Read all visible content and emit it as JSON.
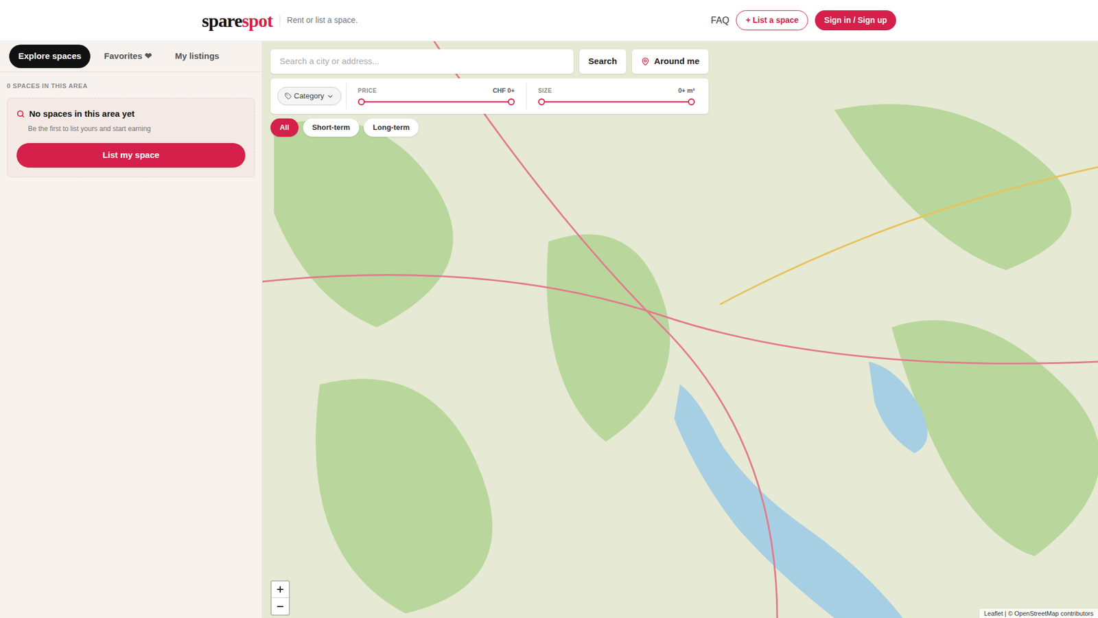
{
  "header": {
    "logo": {
      "part1": "spare",
      "part2": "spot"
    },
    "tagline": "Rent or list a space.",
    "faq": "FAQ",
    "list_button": "+ List a space",
    "sign_in_button": "Sign in / Sign up"
  },
  "sidebar": {
    "tabs": [
      {
        "label": "Explore spaces",
        "selected": true
      },
      {
        "label": "Favorites ❤",
        "selected": false
      },
      {
        "label": "My listings",
        "selected": false
      }
    ],
    "count": "0 SPACES IN THIS AREA",
    "empty_card": {
      "title": "No spaces in this area yet",
      "subtitle": "Be the first to list yours and start earning",
      "button": "List my space"
    }
  },
  "map": {
    "search": {
      "placeholder": "Search a city or address...",
      "button": "Search",
      "around_me": "Around me"
    },
    "filters": {
      "category": "Category",
      "sliders": [
        {
          "label": "PRICE",
          "reading": "CHF 0+",
          "from": 0,
          "level": 1
        },
        {
          "label": "SIZE",
          "reading": "0+ m²",
          "from": 0,
          "level": 1
        }
      ]
    },
    "chips": [
      {
        "label": "All",
        "selected": true
      },
      {
        "label": "Short-term",
        "selected": false
      },
      {
        "label": "Long-term",
        "selected": false
      }
    ],
    "attribution": "Leaflet | © OpenStreetMap contributors"
  }
}
